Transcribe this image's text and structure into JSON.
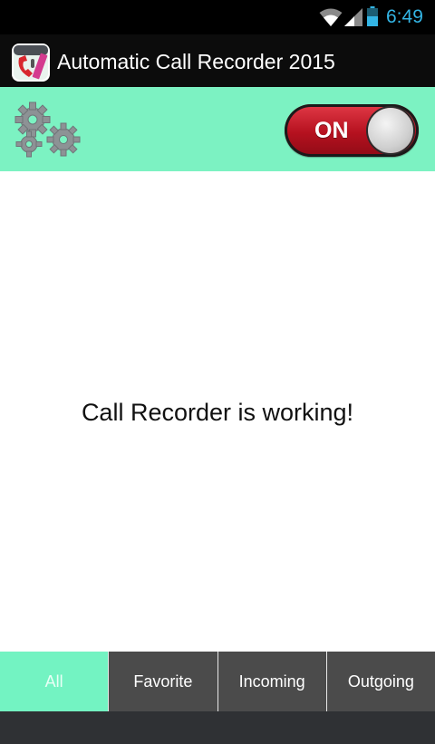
{
  "status_bar": {
    "time": "6:49",
    "icons": [
      "wifi-icon",
      "signal-icon",
      "battery-icon"
    ],
    "time_color": "#33b5e5"
  },
  "action_bar": {
    "app_title": "Automatic Call Recorder 2015",
    "app_icon": "call-recorder-app-icon"
  },
  "toolbar": {
    "settings_icon": "gears-icon",
    "toggle": {
      "label": "ON",
      "state": true
    }
  },
  "main": {
    "message": "Call Recorder is working!"
  },
  "tabs": [
    {
      "label": "All",
      "active": true
    },
    {
      "label": "Favorite",
      "active": false
    },
    {
      "label": "Incoming",
      "active": false
    },
    {
      "label": "Outgoing",
      "active": false
    }
  ],
  "colors": {
    "accent": "#7cf2c2",
    "toggle_on": "#c41a28",
    "tab_inactive": "#4b4b4b",
    "action_bar": "#0c0c0c"
  }
}
